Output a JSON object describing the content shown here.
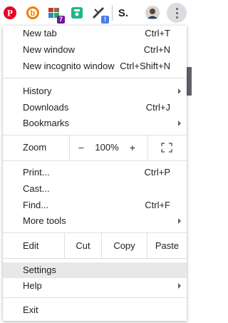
{
  "toolbar": {
    "extensions": [
      {
        "icon": "pinterest-icon",
        "color": "#e60023"
      },
      {
        "icon": "blogger-icon",
        "color": "#f57d00"
      },
      {
        "icon": "extension-icon",
        "color": "#8a6a4c",
        "badge": "7",
        "badge_color": "#6a1b9a"
      },
      {
        "icon": "save-icon",
        "color": "#1db68a"
      },
      {
        "icon": "ruler-icon",
        "color": "#3c4043",
        "badge": "!",
        "badge_color": "#4a7df0"
      },
      {
        "icon": "s-icon",
        "label": "S.",
        "color": "#202124"
      },
      {
        "icon": "profile-avatar-icon",
        "color": "#5a4632"
      }
    ]
  },
  "menu": {
    "new_tab": {
      "label": "New tab",
      "shortcut": "Ctrl+T"
    },
    "new_window": {
      "label": "New window",
      "shortcut": "Ctrl+N"
    },
    "new_incognito": {
      "label": "New incognito window",
      "shortcut": "Ctrl+Shift+N"
    },
    "history": {
      "label": "History"
    },
    "downloads": {
      "label": "Downloads",
      "shortcut": "Ctrl+J"
    },
    "bookmarks": {
      "label": "Bookmarks"
    },
    "zoom": {
      "label": "Zoom",
      "minus": "–",
      "level": "100%",
      "plus": "+"
    },
    "print": {
      "label": "Print...",
      "shortcut": "Ctrl+P"
    },
    "cast": {
      "label": "Cast..."
    },
    "find": {
      "label": "Find...",
      "shortcut": "Ctrl+F"
    },
    "more_tools": {
      "label": "More tools"
    },
    "edit": {
      "label": "Edit",
      "cut": "Cut",
      "copy": "Copy",
      "paste": "Paste"
    },
    "settings": {
      "label": "Settings"
    },
    "help": {
      "label": "Help"
    },
    "exit": {
      "label": "Exit"
    }
  }
}
